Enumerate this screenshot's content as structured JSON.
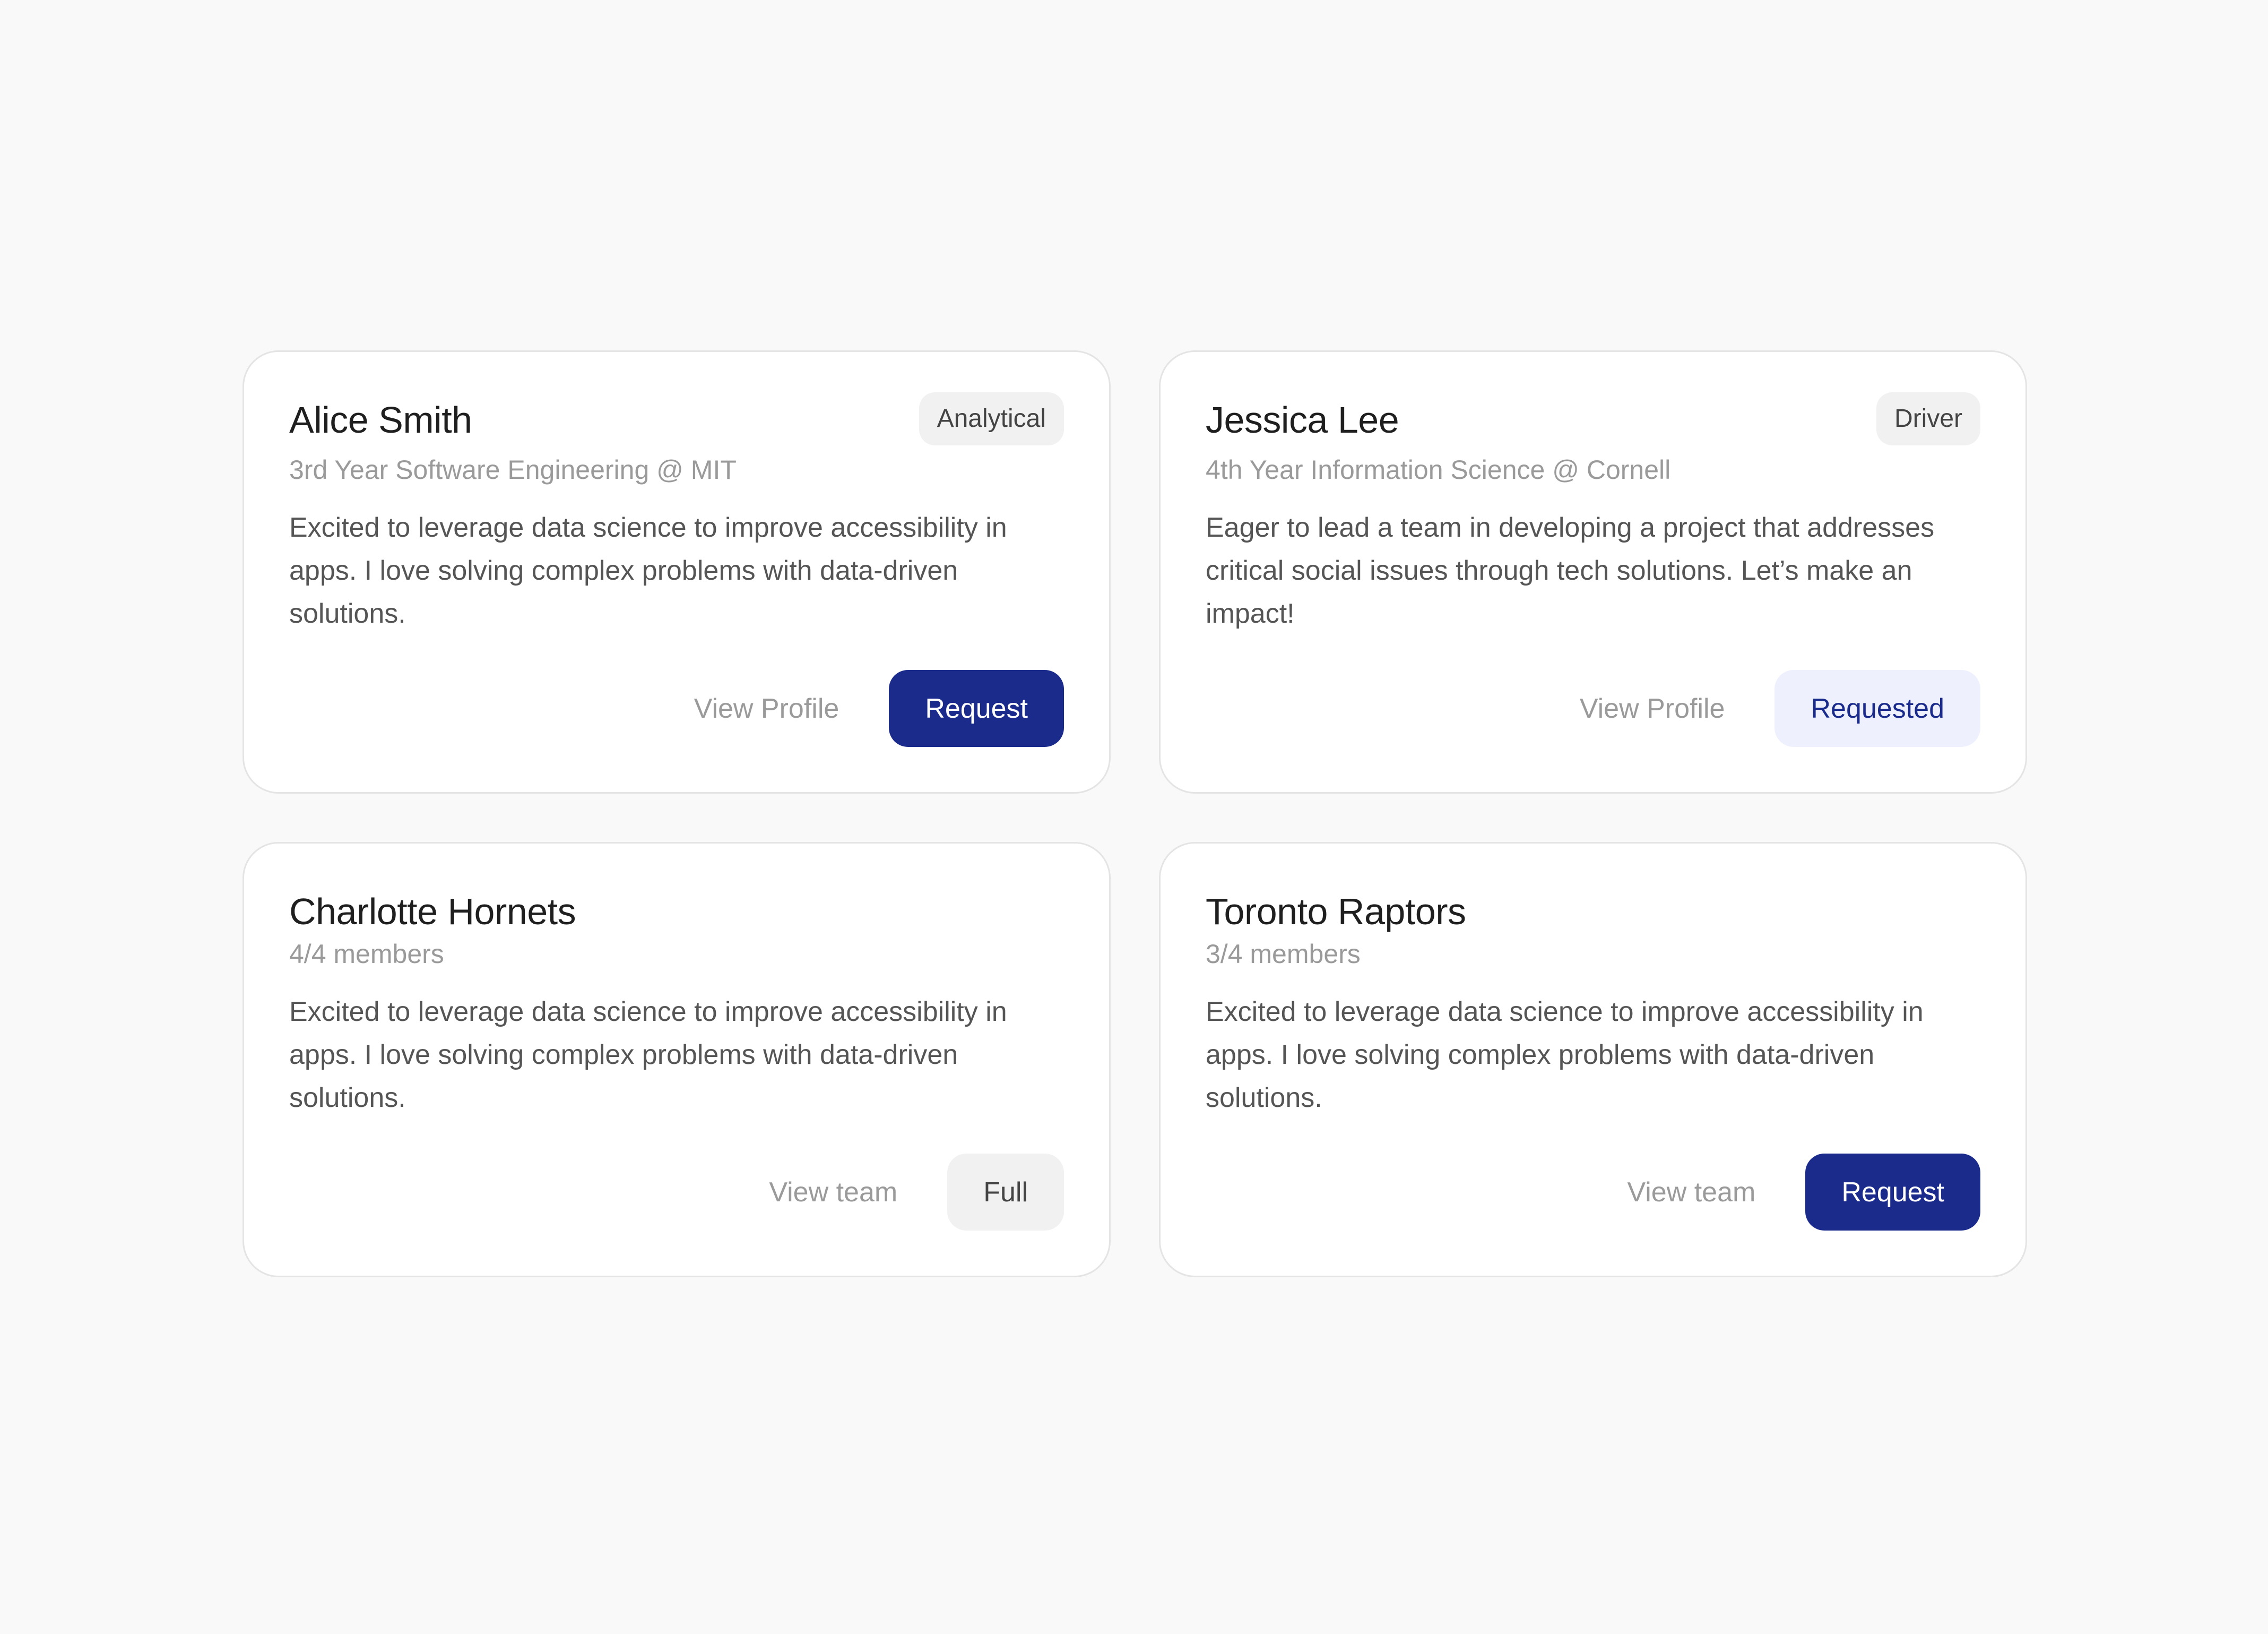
{
  "profiles": [
    {
      "name": "Alice Smith",
      "tag": "Analytical",
      "subtitle": "3rd Year Software Engineering @ MIT",
      "description": "Excited to leverage data science to improve accessibility in apps. I love solving complex problems with data-driven solutions.",
      "link_label": "View Profile",
      "button_label": "Request",
      "button_state": "primary"
    },
    {
      "name": "Jessica Lee",
      "tag": "Driver",
      "subtitle": "4th Year Information Science @ Cornell",
      "description": "Eager to lead a team in developing a project that addresses critical social issues through tech solutions. Let’s make an impact!",
      "link_label": "View Profile",
      "button_label": "Requested",
      "button_state": "requested"
    }
  ],
  "teams": [
    {
      "name": "Charlotte Hornets",
      "members": "4/4 members",
      "description": "Excited to leverage data science to improve accessibility in apps. I love solving complex problems with data-driven solutions.",
      "link_label": "View team",
      "button_label": "Full",
      "button_state": "full"
    },
    {
      "name": "Toronto Raptors",
      "members": "3/4 members",
      "description": "Excited to leverage data science to improve accessibility in apps. I love solving complex problems with data-driven solutions.",
      "link_label": "View team",
      "button_label": "Request",
      "button_state": "primary"
    }
  ],
  "colors": {
    "background": "#f9f9f9",
    "card": "#ffffff",
    "card_border": "#e4e4e4",
    "primary": "#1a2b8c",
    "requested_bg": "#eef1fd",
    "neutral_bg": "#f1f1f1",
    "title_text": "#1f1f1f",
    "muted_text": "#9a9a9a",
    "body_text": "#555555"
  }
}
